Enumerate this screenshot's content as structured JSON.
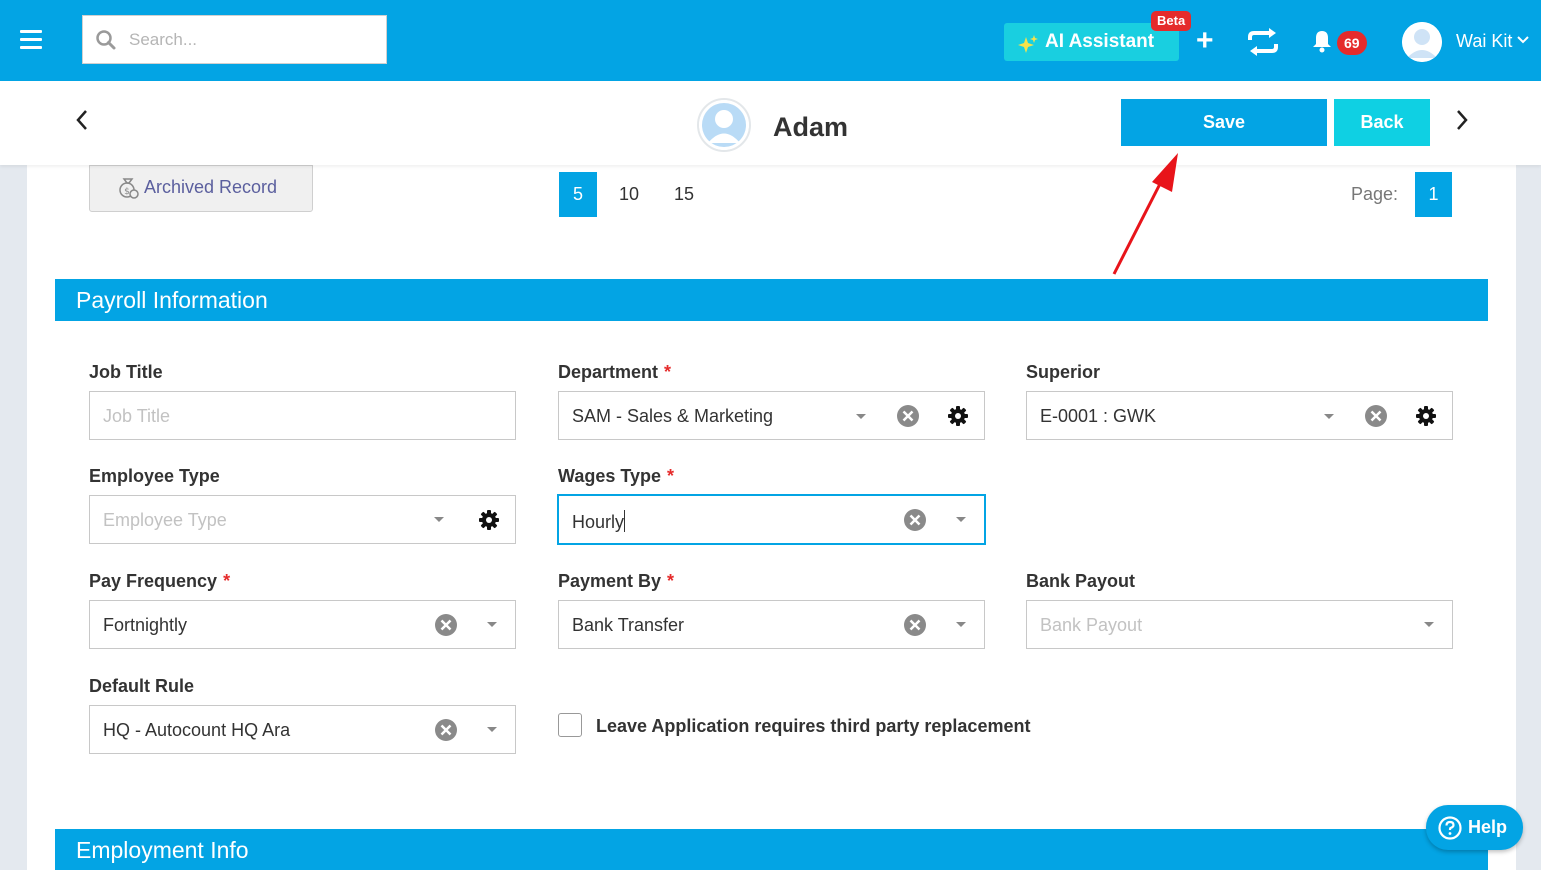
{
  "topbar": {
    "search_placeholder": "Search...",
    "ai_assistant_label": "AI Assistant",
    "beta_badge": "Beta",
    "add_label": "+",
    "notification_count": "69",
    "user_name": "Wai Kit"
  },
  "record": {
    "name": "Adam",
    "save_label": "Save",
    "back_label": "Back"
  },
  "toolbar": {
    "archived_label": "Archived Record",
    "page_sizes": [
      "5",
      "10",
      "15"
    ],
    "active_page_size": "5",
    "page_label": "Page:",
    "current_page": "1"
  },
  "payroll": {
    "section_title": "Payroll Information",
    "job_title": {
      "label": "Job Title",
      "placeholder": "Job Title",
      "required": false
    },
    "department": {
      "label": "Department",
      "value": "SAM - Sales & Marketing",
      "required": true
    },
    "superior": {
      "label": "Superior",
      "value": "E-0001 : GWK",
      "required": false
    },
    "employee_type": {
      "label": "Employee Type",
      "placeholder": "Employee Type",
      "required": false
    },
    "wages_type": {
      "label": "Wages Type",
      "value": "Hourly",
      "required": true
    },
    "pay_frequency": {
      "label": "Pay Frequency",
      "value": "Fortnightly",
      "required": true
    },
    "payment_by": {
      "label": "Payment By",
      "value": "Bank Transfer",
      "required": true
    },
    "bank_payout": {
      "label": "Bank Payout",
      "placeholder": "Bank Payout",
      "required": false
    },
    "default_rule": {
      "label": "Default Rule",
      "value": "HQ - Autocount HQ Ara",
      "required": false
    },
    "leave_checkbox": {
      "label": "Leave Application requires third party replacement",
      "checked": false
    }
  },
  "employment": {
    "section_title": "Employment Info"
  },
  "help": {
    "label": "Help"
  },
  "colors": {
    "primary": "#03a4e4",
    "accent_cyan": "#0fd0e3",
    "badge_red": "#e52b2b",
    "annotation_arrow": "#e8141a"
  },
  "icons": [
    "menu-icon",
    "search-icon",
    "sparkle-icon",
    "plus-icon",
    "sync-icon",
    "bell-icon",
    "user-avatar-icon",
    "chevron-down-icon",
    "chevron-left-icon",
    "chevron-right-icon",
    "money-bag-icon",
    "clear-icon",
    "gear-icon",
    "caret-down-icon",
    "help-circle-icon"
  ]
}
